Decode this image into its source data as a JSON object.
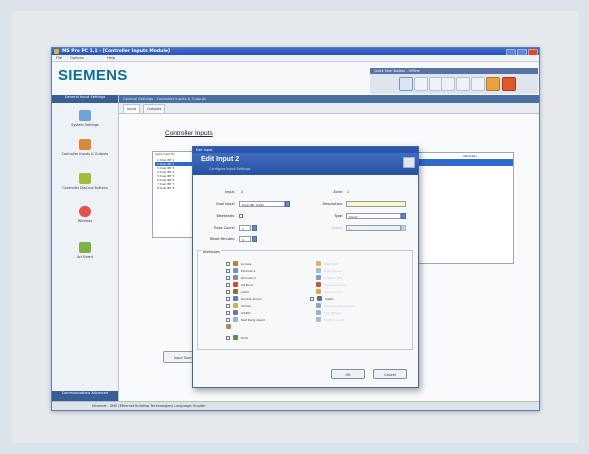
{
  "window": {
    "title": "MS Pro PC 1.1 - [Controller Inputs Module]",
    "menu": [
      "File",
      "Options",
      "Help"
    ]
  },
  "brand": "SIEMENS",
  "quick_toolbar": {
    "title": "Quick Task Toolbar - Offline",
    "icons": [
      "connect-icon",
      "disconnect-icon",
      "upload-icon",
      "download-icon",
      "settings-icon",
      "help-icon",
      "refresh-icon",
      "alarm-icon"
    ]
  },
  "sidebar": {
    "header": "General\nInput Settings",
    "items": [
      {
        "label": "System Settings",
        "icon": "system-settings-icon"
      },
      {
        "label": "Controller Inputs & Outputs",
        "icon": "controller-inputs-icon"
      },
      {
        "label": "Controller Dial-out Buttons",
        "icon": "controller-buttons-icon"
      },
      {
        "label": "Wireless",
        "icon": "wireless-icon"
      },
      {
        "label": "Art Event",
        "icon": "art-event-icon"
      }
    ],
    "footer": "Communications\nAdvanced"
  },
  "content": {
    "breadcrumb": "General Settings : Controller Inputs & Outputs",
    "tabs": [
      "Input",
      "Outputs"
    ],
    "title": "Controller Inputs",
    "list_header": "Input  Input ID",
    "list_rows": [
      "1 Dual INT 1",
      "2 Dual INT 2",
      "3 Dual INT 3",
      "4 Dual INT 4",
      "5 Dual INT 5",
      "6 Dual INT 6",
      "7 Dual INT 7",
      "8 Dual INT 8"
    ],
    "right_header": "Attributes",
    "summary_button": "Input Summary"
  },
  "dialog": {
    "top_label": "Edit Input",
    "title": "Edit Input 2",
    "subtitle": "Configure Input Settings",
    "fields": {
      "input_label": "Input:",
      "input_value": "2",
      "zone_label": "Zone:",
      "zone_value": "1",
      "dual_label": "Dual Input:",
      "dual_value": "Dual INT (2SP)",
      "desc_label": "Description:",
      "desc_value": "",
      "weekends_label": "Weekends:",
      "type_label": "Type:",
      "type_value": "Alarm",
      "pulse_label": "Pulse Count:",
      "pulse_value": "1",
      "alarm_label": "Alarm:",
      "alarm_value": "1",
      "reset_label": "Reset Minutes:",
      "reset_value": "0"
    },
    "attributes_title": "Attributes",
    "attributes_left": [
      "Access",
      "Exclude 1",
      "Exclude 2",
      "24 Hour",
      "Latch",
      "Double Knock",
      "Chime",
      "Inhibit",
      "Test Daily Alarm",
      "Walk",
      "Hold"
    ],
    "attributes_right": [
      "Walk Test",
      "Entry Route",
      "Custom Text",
      "Force Armable",
      "Access Lock",
      "Silent",
      "Wireless Supervision",
      "Log Tamper",
      "Monitor Input"
    ],
    "ok_label": "OK",
    "cancel_label": "Cancel"
  },
  "statusbar": "Ethernet - SMS (Ethernet Building Technologies)    Language: English"
}
